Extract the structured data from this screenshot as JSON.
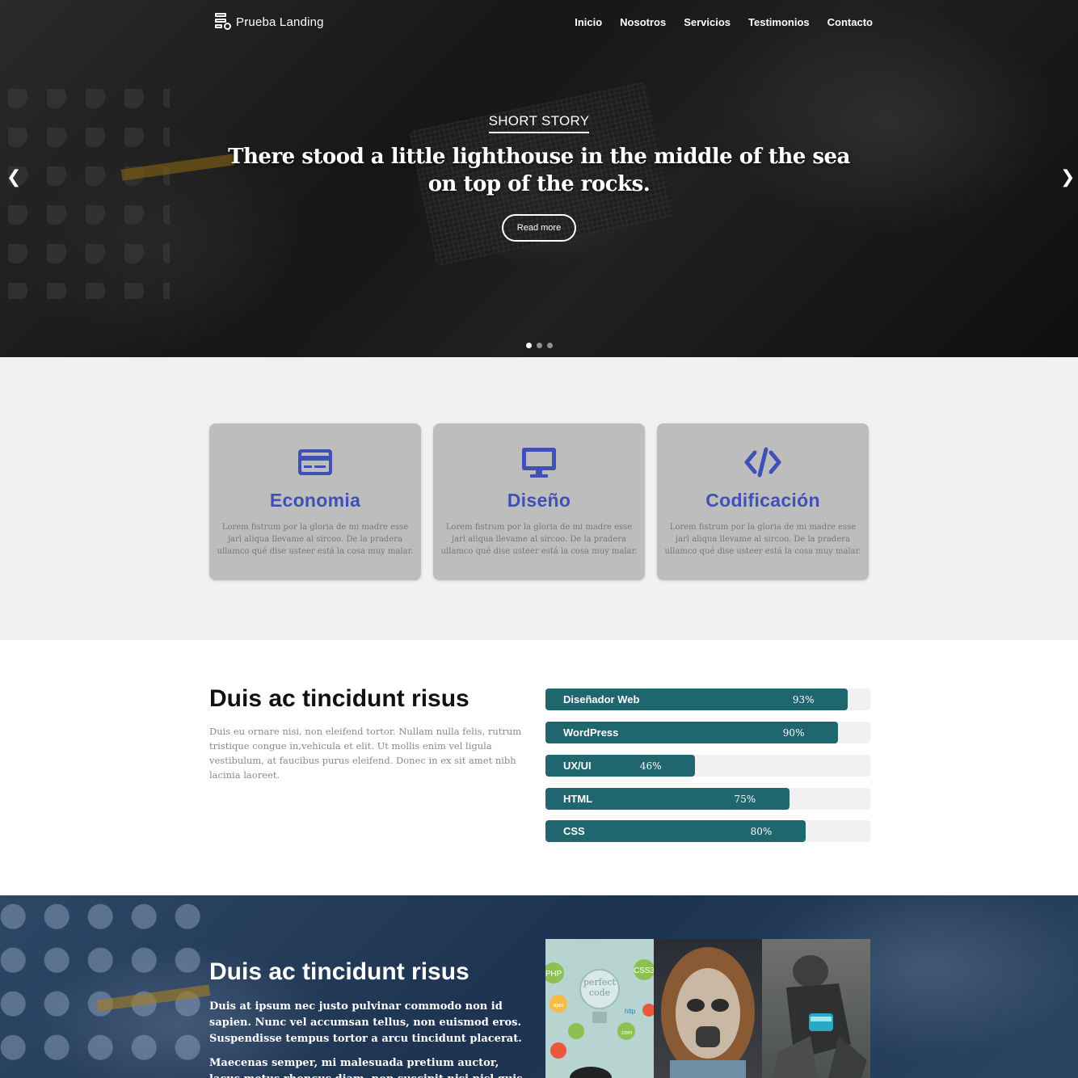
{
  "nav": {
    "brand": "Prueba Landing",
    "items": [
      {
        "label": "Inicio"
      },
      {
        "label": "Nosotros"
      },
      {
        "label": "Servicios"
      },
      {
        "label": "Testimonios"
      },
      {
        "label": "Contacto"
      }
    ]
  },
  "hero": {
    "kicker": "SHORT STORY",
    "headline": "There stood a little lighthouse in the middle of the sea on top of the rocks.",
    "button": "Read more",
    "slides_count": 3,
    "active_slide": 1
  },
  "features": [
    {
      "title": "Economia",
      "icon": "credit-card-icon",
      "text": "Lorem fistrum por la gloria de mi madre esse jarl aliqua llevame al sircoo. De la pradera ullamco qué dise usteer está la cosa muy malar."
    },
    {
      "title": "Diseño",
      "icon": "monitor-icon",
      "text": "Lorem fistrum por la gloria de mi madre esse jarl aliqua llevame al sircoo. De la pradera ullamco qué dise usteer está la cosa muy malar."
    },
    {
      "title": "Codificación",
      "icon": "code-icon",
      "text": "Lorem fistrum por la gloria de mi madre esse jarl aliqua llevame al sircoo. De la pradera ullamco qué dise usteer está la cosa muy malar."
    }
  ],
  "skills": {
    "title": "Duis ac tincidunt risus",
    "text": "Duis eu ornare nisi, non eleifend tortor. Nullam nulla felis, rutrum tristique congue in,vehicula et elit. Ut mollis enim vel ligula vestibulum, at faucibus purus eleifend. Donec in ex sit amet nibh lacinia laoreet.",
    "bars": [
      {
        "label": "Diseñador Web",
        "percent": 93,
        "display": "93%"
      },
      {
        "label": "WordPress",
        "percent": 90,
        "display": "90%"
      },
      {
        "label": "UX/UI",
        "percent": 46,
        "display": "46%"
      },
      {
        "label": "HTML",
        "percent": 75,
        "display": "75%"
      },
      {
        "label": "CSS",
        "percent": 80,
        "display": "80%"
      }
    ]
  },
  "portfolio": {
    "title": "Duis ac tincidunt risus",
    "p1": "Duis at ipsum nec justo pulvinar commodo non id sapien. Nunc vel accumsan tellus, non euismod eros. Suspendisse tempus tortor a arcu tincidunt placerat.",
    "p2": "Maecenas semper, mi malesuada pretium auctor, lacus metus rhoncus diam, non suscipit nisi nisl quis ipsum.",
    "thumb1_texts": [
      "PHP",
      "CSS3",
      "perfect",
      "code",
      "http",
      ".com",
      "ajax"
    ]
  },
  "colors": {
    "accent": "#3f51b5",
    "bar": "#1f666e",
    "bar_track": "#f1f1f1",
    "card": "#bdbdbd",
    "features_bg": "#f1f1f1"
  }
}
